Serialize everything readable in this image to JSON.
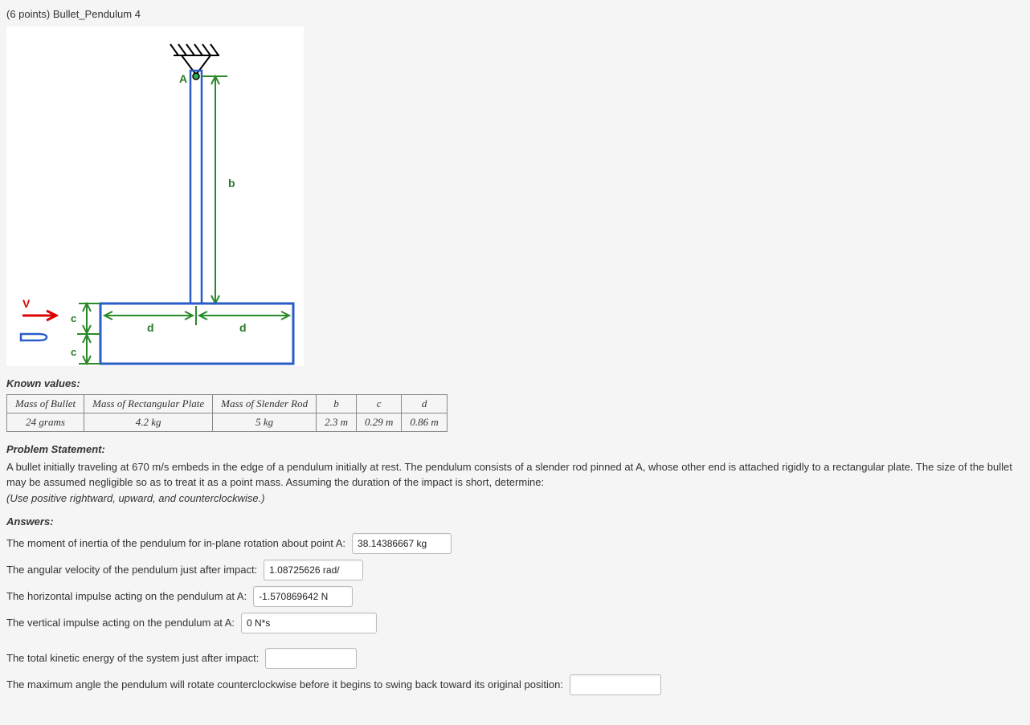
{
  "header": {
    "points_prefix": "(6 points) ",
    "title": "Bullet_Pendulum 4"
  },
  "diagram": {
    "labels": {
      "A": "A",
      "b": "b",
      "c_top": "c",
      "c_bot": "c",
      "d_left": "d",
      "d_right": "d",
      "V": "V"
    }
  },
  "known": {
    "label": "Known values:",
    "headers": [
      "Mass of Bullet",
      "Mass of Rectangular Plate",
      "Mass of Slender Rod",
      "b",
      "c",
      "d"
    ],
    "values": [
      "24 grams",
      "4.2 kg",
      "5 kg",
      "2.3 m",
      "0.29 m",
      "0.86 m"
    ]
  },
  "problem": {
    "label": "Problem Statement:",
    "text": "A bullet initially traveling at 670 m/s embeds in the edge of a pendulum initially at rest. The pendulum consists of a slender rod pinned at A, whose other end is attached rigidly to a rectangular plate. The size of the bullet may be assumed negligible so as to treat it as a point mass. Assuming the duration of the impact is short, determine:",
    "note": "(Use positive rightward, upward, and counterclockwise.)"
  },
  "answers": {
    "label": "Answers:",
    "lines": [
      {
        "text": "The moment of inertia of the pendulum for in-plane rotation about point A:",
        "value": "38.14386667 kg"
      },
      {
        "text": "The angular velocity of the pendulum just after impact:",
        "value": "1.08725626 rad/"
      },
      {
        "text": "The horizontal impulse acting on the pendulum at A:",
        "value": "-1.570869642 N"
      },
      {
        "text": "The vertical impulse acting on the pendulum at A:",
        "value": "0 N*s"
      },
      {
        "text": "The total kinetic energy of the system just after impact:",
        "value": ""
      },
      {
        "text": "The maximum angle the pendulum will rotate counterclockwise before it begins to swing back toward its original position:",
        "value": ""
      }
    ]
  }
}
